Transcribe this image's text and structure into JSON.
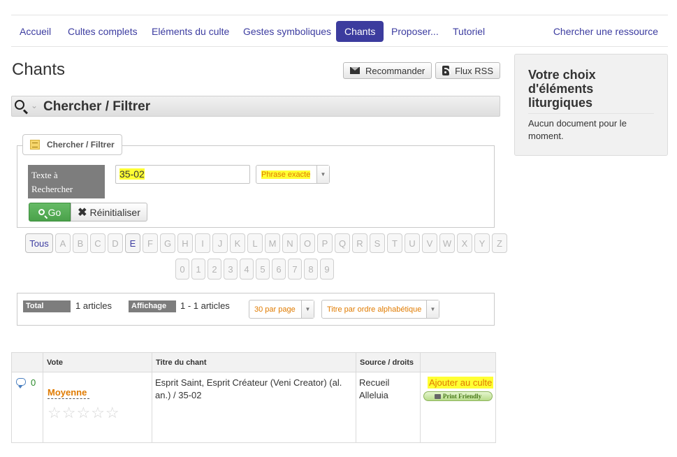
{
  "nav": {
    "items": [
      {
        "label": "Accueil"
      },
      {
        "label": "Cultes complets"
      },
      {
        "label": "Eléments du culte"
      },
      {
        "label": "Gestes symboliques"
      },
      {
        "label": "Chants"
      },
      {
        "label": "Proposer..."
      },
      {
        "label": "Tutoriel"
      }
    ],
    "active": "Chants",
    "search_label": "Chercher une ressource"
  },
  "page": {
    "title": "Chants",
    "recommend_label": "Recommander",
    "rss_label": "Flux RSS"
  },
  "filter": {
    "bar_title": "Chercher / Filtrer",
    "legend": "Chercher / Filtrer",
    "text_label": "Texte à Rechercher",
    "text_value": "35-02",
    "mode_value": "Phrase exacte",
    "go_label": "Go",
    "reset_label": "Réinitialiser"
  },
  "alphabet": {
    "all_label": "Tous",
    "letters": [
      "A",
      "B",
      "C",
      "D",
      "E",
      "F",
      "G",
      "H",
      "I",
      "J",
      "K",
      "L",
      "M",
      "N",
      "O",
      "P",
      "Q",
      "R",
      "S",
      "T",
      "U",
      "V",
      "W",
      "X",
      "Y",
      "Z"
    ],
    "digits": [
      "0",
      "1",
      "2",
      "3",
      "4",
      "5",
      "6",
      "7",
      "8",
      "9"
    ],
    "enabled": [
      "Tous",
      "E"
    ]
  },
  "totals": {
    "total_label": "Total",
    "total_value": "1 articles",
    "display_label": "Affichage",
    "display_value": "1 - 1 articles",
    "per_page": "30 par page",
    "sort": "Titre par ordre alphabétique"
  },
  "table": {
    "headers": {
      "vote": "Vote",
      "title": "Titre du chant",
      "source": "Source / droits"
    },
    "rows": [
      {
        "comments": "0",
        "rating": "Moyenne",
        "stars": "☆☆☆☆☆",
        "title": "Esprit Saint, Esprit Créateur (Veni Creator) (al. an.) / 35-02",
        "source": "Recueil Alleluia",
        "add_label": "Ajouter au culte",
        "print_label": "Print Friendly"
      }
    ]
  },
  "sidebar": {
    "title": "Votre choix d'éléments liturgiques",
    "empty": "Aucun document pour le moment."
  }
}
